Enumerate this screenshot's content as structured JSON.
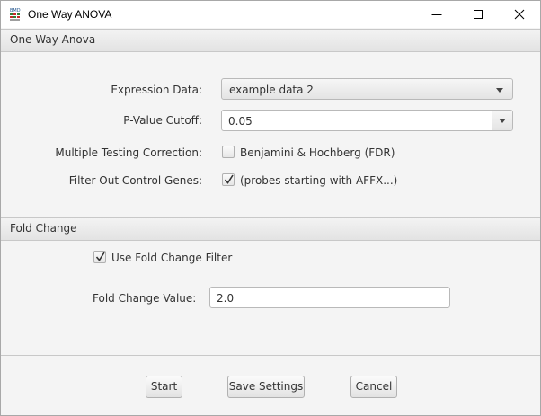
{
  "window": {
    "title": "One Way ANOVA",
    "icon": "bmd-app-icon"
  },
  "section_anova": {
    "header": "One Way Anova",
    "expression_data": {
      "label": "Expression Data:",
      "value": "example data 2"
    },
    "pvalue": {
      "label": "P-Value Cutoff:",
      "value": "0.05"
    },
    "multiple_testing": {
      "label": "Multiple Testing Correction:",
      "option": "Benjamini & Hochberg (FDR)",
      "checked": false
    },
    "filter_control": {
      "label": "Filter Out Control Genes:",
      "option": "(probes starting with AFFX...)",
      "checked": true
    }
  },
  "section_fold": {
    "header": "Fold Change",
    "use_filter": {
      "label": "Use Fold Change Filter",
      "checked": true
    },
    "fold_value": {
      "label": "Fold Change Value:",
      "value": "2.0"
    }
  },
  "buttons": {
    "start": "Start",
    "save": "Save Settings",
    "cancel": "Cancel"
  }
}
